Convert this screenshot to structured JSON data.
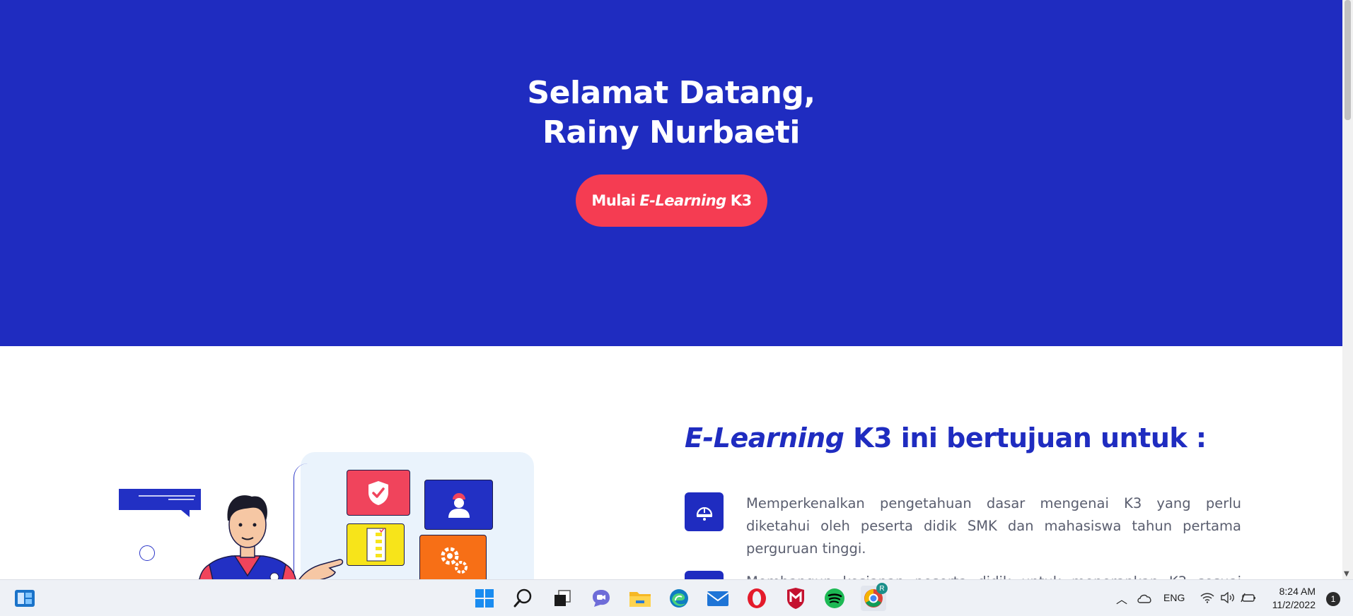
{
  "hero": {
    "title_line1": "Selamat Datang,",
    "title_line2": "Rainy Nurbaeti",
    "cta_prefix": "Mulai",
    "cta_italic": "E-Learning",
    "cta_suffix": "K3"
  },
  "purpose": {
    "title_italic": "E-Learning",
    "title_rest": "K3 ini bertujuan untuk :",
    "items": [
      {
        "icon": "helmet-icon",
        "text": "Memperkenalkan pengetahuan dasar mengenai K3 yang perlu diketahui oleh peserta didik SMK dan mahasiswa tahun pertama perguruan tinggi."
      },
      {
        "icon": "book-icon",
        "text": "Membangun kesiapan peserta didik untuk menerapkan K3 sesuai dengan yang dipelajari"
      }
    ]
  },
  "taskbar": {
    "language": "ENG",
    "time": "8:24 AM",
    "date": "11/2/2022",
    "notification_count": "1",
    "chrome_badge": "R",
    "icons": [
      "widgets-icon",
      "windows-start-icon",
      "search-icon",
      "task-view-icon",
      "teams-chat-icon",
      "file-explorer-icon",
      "edge-icon",
      "mail-icon",
      "opera-icon",
      "mcafee-icon",
      "spotify-icon",
      "chrome-icon"
    ]
  },
  "colors": {
    "primary": "#1f2cc0",
    "accent": "#f53c52",
    "text_muted": "#5a5e6f"
  }
}
